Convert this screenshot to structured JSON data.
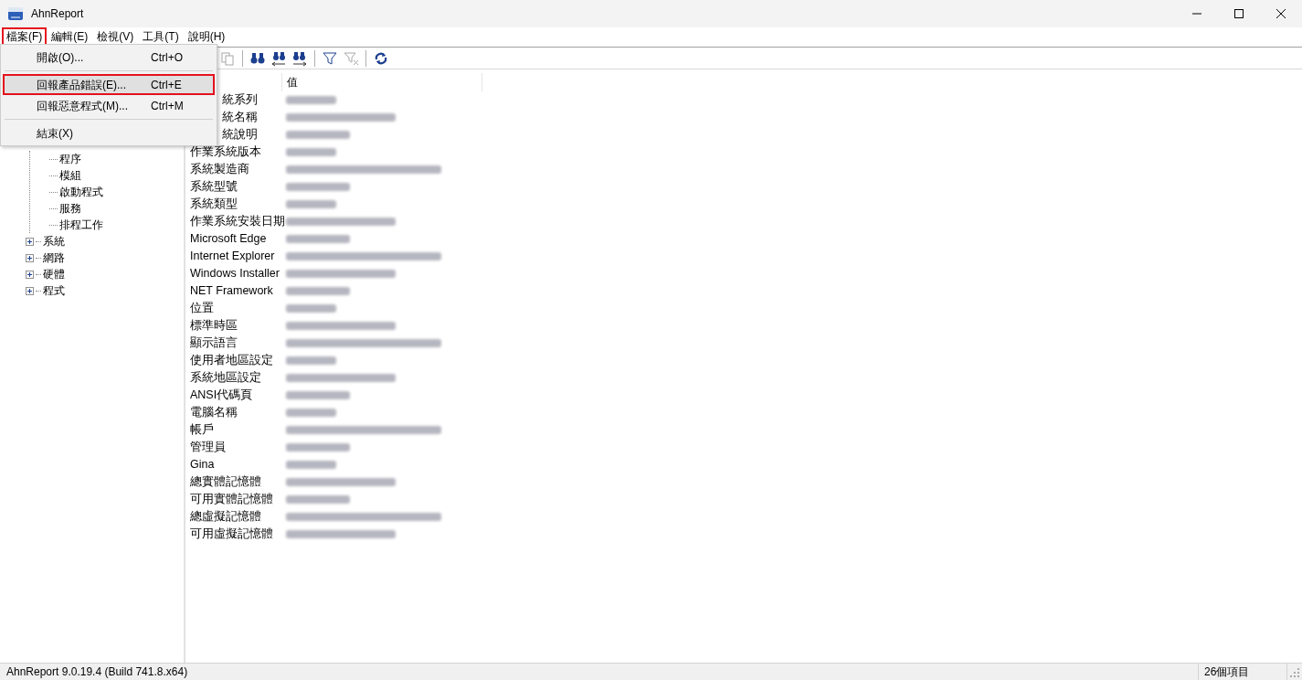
{
  "window": {
    "title": "AhnReport"
  },
  "menu_bar": [
    {
      "label": "檔案(F)",
      "annotated": true
    },
    {
      "label": "編輯(E)",
      "annotated": false
    },
    {
      "label": "檢視(V)",
      "annotated": false
    },
    {
      "label": "工具(T)",
      "annotated": false
    },
    {
      "label": "說明(H)",
      "annotated": false
    }
  ],
  "open_menu": {
    "items": [
      {
        "kind": "item",
        "label": "開啟(O)...",
        "shortcut": "Ctrl+O",
        "selected": false,
        "annotated": false
      },
      {
        "kind": "separator"
      },
      {
        "kind": "item",
        "label": "回報產品錯誤(E)...",
        "shortcut": "Ctrl+E",
        "selected": true,
        "annotated": true
      },
      {
        "kind": "item",
        "label": "回報惡意程式(M)...",
        "shortcut": "Ctrl+M",
        "selected": false,
        "annotated": false
      },
      {
        "kind": "separator"
      },
      {
        "kind": "item",
        "label": "結束(X)",
        "selected": false,
        "annotated": false
      }
    ]
  },
  "toolbar": [
    {
      "kind": "copy",
      "disabled": true
    },
    {
      "kind": "separator"
    },
    {
      "kind": "find",
      "disabled": false
    },
    {
      "kind": "find-prev",
      "disabled": false
    },
    {
      "kind": "find-next",
      "disabled": false
    },
    {
      "kind": "separator"
    },
    {
      "kind": "filter",
      "disabled": false
    },
    {
      "kind": "clear-filter",
      "disabled": true
    },
    {
      "kind": "separator"
    },
    {
      "kind": "refresh",
      "disabled": false
    }
  ],
  "tree": [
    {
      "children": [
        {
          "label": "程序"
        },
        {
          "label": "模組"
        },
        {
          "label": "啟動程式"
        },
        {
          "label": "服務"
        },
        {
          "label": "排程工作"
        }
      ]
    },
    {
      "label": "系統",
      "expanded": false
    },
    {
      "label": "網路",
      "expanded": false
    },
    {
      "label": "硬體",
      "expanded": false
    },
    {
      "label": "程式",
      "expanded": false
    }
  ],
  "table": {
    "columns": [
      "值"
    ],
    "rows": [
      {
        "property": "統系列",
        "value_blurred": true
      },
      {
        "property": "統名稱",
        "value_blurred": true
      },
      {
        "property": "統說明",
        "value_blurred": true
      },
      {
        "property": "作業系統版本",
        "value_blurred": true
      },
      {
        "property": "系統製造商",
        "value_blurred": true
      },
      {
        "property": "系統型號",
        "value_blurred": true
      },
      {
        "property": "系統類型",
        "value_blurred": true
      },
      {
        "property": "作業系統安裝日期",
        "value_blurred": true
      },
      {
        "property": "Microsoft Edge",
        "value_blurred": true
      },
      {
        "property": "Internet Explorer",
        "value_blurred": true
      },
      {
        "property": "Windows Installer",
        "value_blurred": true
      },
      {
        "property": "NET Framework",
        "value_blurred": true
      },
      {
        "property": "位置",
        "value_blurred": true
      },
      {
        "property": "標準時區",
        "value_blurred": true
      },
      {
        "property": "顯示語言",
        "value_blurred": true
      },
      {
        "property": "使用者地區設定",
        "value_blurred": true
      },
      {
        "property": "系統地區設定",
        "value_blurred": true
      },
      {
        "property": "ANSI代碼頁",
        "value_blurred": true
      },
      {
        "property": "電腦名稱",
        "value_blurred": true
      },
      {
        "property": "帳戶",
        "value_blurred": true
      },
      {
        "property": "管理員",
        "value_blurred": true
      },
      {
        "property": "Gina",
        "value_blurred": true
      },
      {
        "property": "總實體記憶體",
        "value_blurred": true
      },
      {
        "property": "可用實體記憶體",
        "value_blurred": true
      },
      {
        "property": "總虛擬記憶體",
        "value_blurred": true
      },
      {
        "property": "可用虛擬記憶體",
        "value_blurred": true
      }
    ]
  },
  "status_bar": {
    "left": "AhnReport 9.0.19.4 (Build 741.8.x64)",
    "right": "26個項目"
  }
}
